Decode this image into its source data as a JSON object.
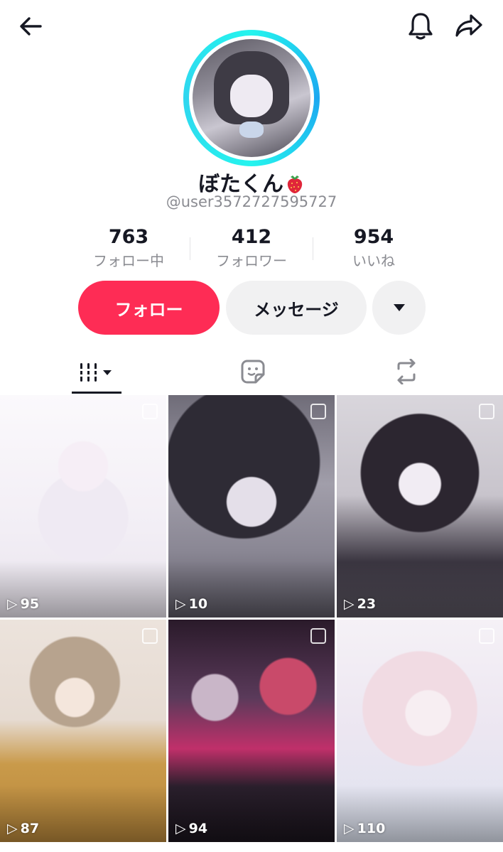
{
  "profile": {
    "display_name": "ぼたくん",
    "name_emoji": "strawberry-icon",
    "handle": "@user3572727595727"
  },
  "stats": [
    {
      "value": "763",
      "label": "フォロー中"
    },
    {
      "value": "412",
      "label": "フォロワー"
    },
    {
      "value": "954",
      "label": "いいね"
    }
  ],
  "actions": {
    "follow_label": "フォロー",
    "message_label": "メッセージ"
  },
  "tabs": [
    {
      "name": "videos",
      "icon": "grid-bars-icon",
      "active": true
    },
    {
      "name": "liked",
      "icon": "sticker-icon",
      "active": false
    },
    {
      "name": "reposts",
      "icon": "repost-icon",
      "active": false
    }
  ],
  "videos": [
    {
      "views": "95"
    },
    {
      "views": "10"
    },
    {
      "views": "23"
    },
    {
      "views": "87"
    },
    {
      "views": "94"
    },
    {
      "views": "110"
    }
  ],
  "colors": {
    "accent": "#fe2c55",
    "ring": "#25f4ee",
    "secondary_text": "#8a8b91",
    "button_bg": "#f1f1f2"
  }
}
